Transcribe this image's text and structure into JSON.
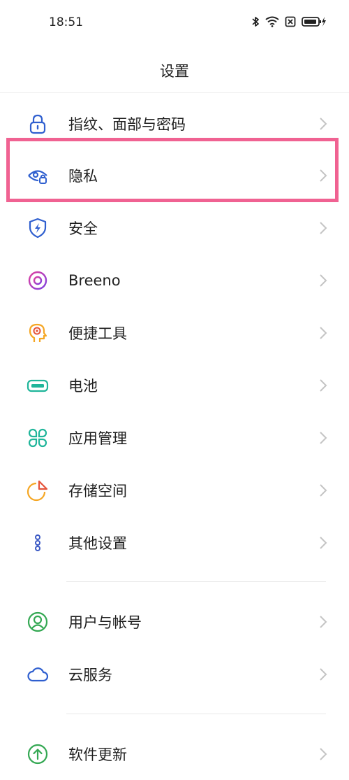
{
  "status_bar": {
    "time": "18:51"
  },
  "header": {
    "title": "设置"
  },
  "settings_items": [
    {
      "label": "指纹、面部与密码",
      "icon": "lock-icon",
      "color": "#2f5fcf"
    },
    {
      "label": "隐私",
      "icon": "privacy-eye-icon",
      "color": "#2f5fcf"
    },
    {
      "label": "安全",
      "icon": "security-shield-icon",
      "color": "#2f5fcf"
    },
    {
      "label": "Breeno",
      "icon": "breeno-icon",
      "color": "#c13fd6"
    },
    {
      "label": "便捷工具",
      "icon": "convenience-tools-icon",
      "color": "#f5a623"
    },
    {
      "label": "电池",
      "icon": "battery-icon",
      "color": "#1fb59a"
    },
    {
      "label": "应用管理",
      "icon": "app-management-icon",
      "color": "#1fb59a"
    },
    {
      "label": "存储空间",
      "icon": "storage-icon",
      "color": "#f5a623"
    },
    {
      "label": "其他设置",
      "icon": "other-settings-icon",
      "color": "#3b59c4"
    },
    {
      "label": "用户与帐号",
      "icon": "user-account-icon",
      "color": "#34a853"
    },
    {
      "label": "云服务",
      "icon": "cloud-icon",
      "color": "#2f5fcf"
    },
    {
      "label": "软件更新",
      "icon": "software-update-icon",
      "color": "#34a853"
    }
  ],
  "highlight_color": "#f06292"
}
